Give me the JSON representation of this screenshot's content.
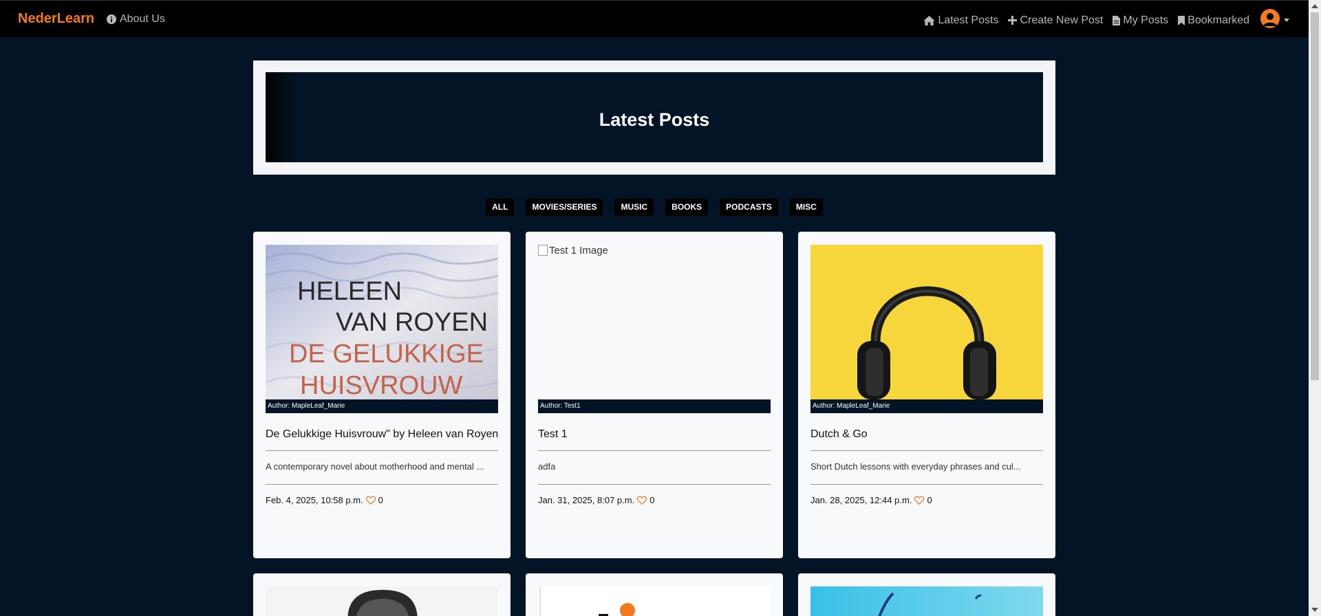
{
  "navbar": {
    "brand": "NederLearn",
    "about": "About Us",
    "links": {
      "latest": "Latest Posts",
      "create": "Create New Post",
      "my": "My Posts",
      "bookmarked": "Bookmarked"
    }
  },
  "hero": {
    "title": "Latest Posts"
  },
  "filters": [
    "ALL",
    "MOVIES/SERIES",
    "MUSIC",
    "BOOKS",
    "PODCASTS",
    "MISC"
  ],
  "colors": {
    "accent": "#f37a1f",
    "background": "#021426",
    "card": "#f8f9fa"
  },
  "posts": [
    {
      "image_alt": "De Gelukkige Huisvrouw book cover",
      "cover_line1": "HELEEN",
      "cover_line2": "VAN ROYEN",
      "cover_line3": "DE GELUKKIGE",
      "cover_line4": "HUISVROUW",
      "author": "Author: MapleLeaf_Marie",
      "title": "De Gelukkige Huisvrouw\" by Heleen van Royen",
      "description": "A contemporary novel about motherhood and mental ...",
      "date": "Feb. 4, 2025, 10:58 p.m.",
      "likes": "0"
    },
    {
      "image_alt": "Test 1 Image",
      "author": "Author: Test1",
      "title": "Test 1",
      "description": "adfa",
      "date": "Jan. 31, 2025, 8:07 p.m.",
      "likes": "0"
    },
    {
      "image_alt": "Headphones on yellow background",
      "author": "Author: MapleLeaf_Marie",
      "title": "Dutch & Go",
      "description": "Short Dutch lessons with everyday phrases and cul...",
      "date": "Jan. 28, 2025, 12:44 p.m.",
      "likes": "0"
    }
  ]
}
